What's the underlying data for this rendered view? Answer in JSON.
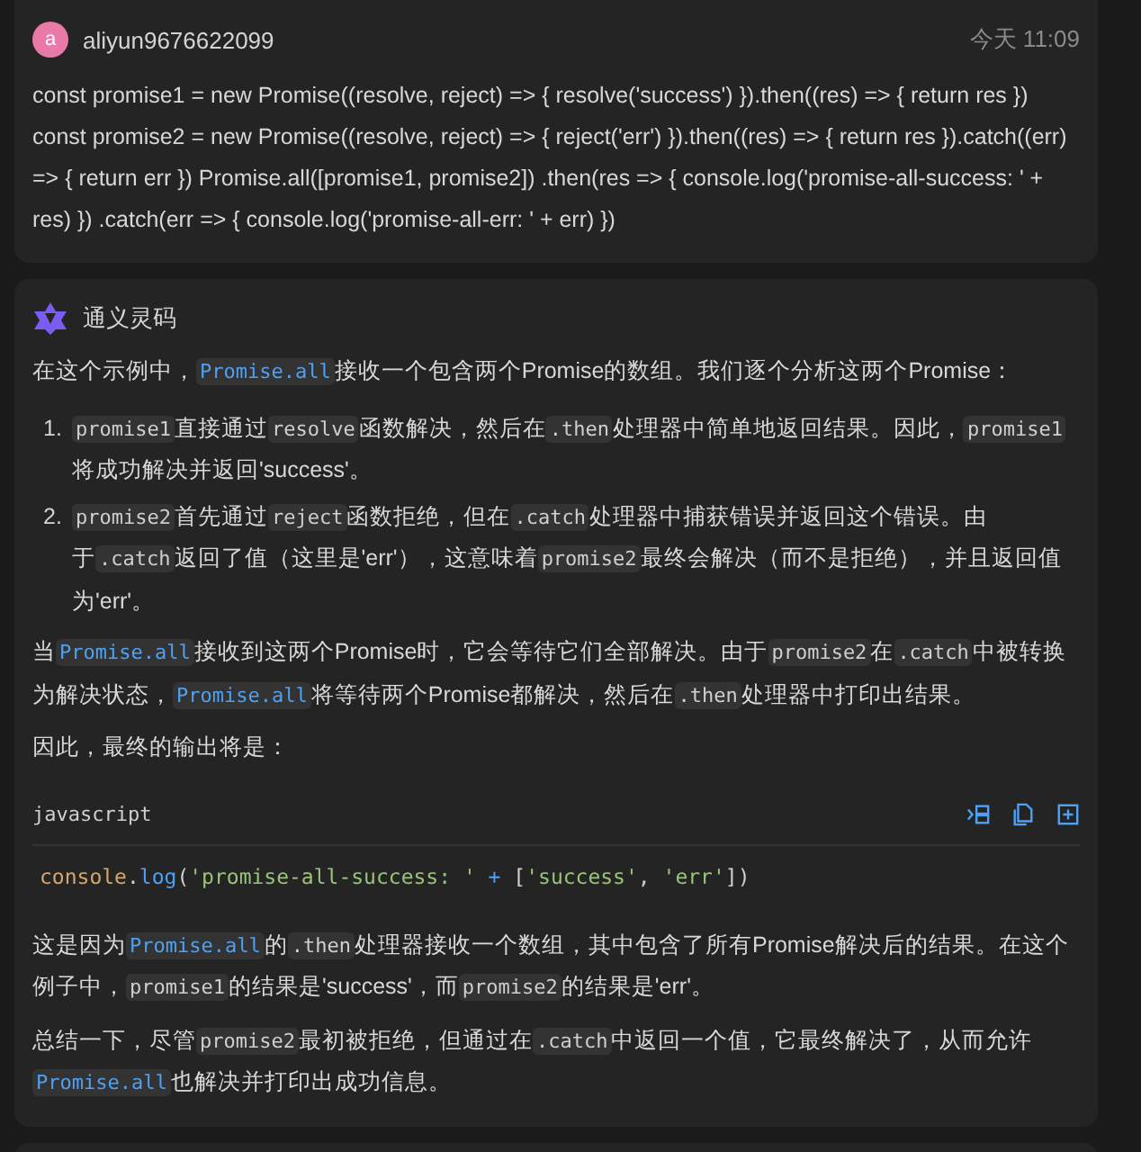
{
  "user_message": {
    "avatar_letter": "a",
    "username": "aliyun9676622099",
    "time": "今天 11:09",
    "text": "const promise1 = new Promise((resolve, reject) => { resolve('success') }).then((res) => { return res }) const promise2 = new Promise((resolve, reject) => { reject('err') }).then((res) => { return res }).catch((err) => { return err }) Promise.all([promise1, promise2]) .then(res => { console.log('promise-all-success:  ' + res) }) .catch(err => { console.log('promise-all-err:  ' + err) })"
  },
  "assistant_message": {
    "name": "通义灵码",
    "blocks": [
      {
        "kind": "paragraph",
        "segments": [
          {
            "kind": "text",
            "text": "在这个示例中，"
          },
          {
            "kind": "api",
            "text": "Promise.all"
          },
          {
            "kind": "text",
            "text": "接收一个包含两个Promise的数组。我们逐个分析这两个Promise："
          }
        ]
      },
      {
        "kind": "list",
        "items": [
          {
            "number": "1.",
            "segments": [
              {
                "kind": "code",
                "text": "promise1"
              },
              {
                "kind": "text",
                "text": "直接通过"
              },
              {
                "kind": "code",
                "text": "resolve"
              },
              {
                "kind": "text",
                "text": "函数解决，然后在"
              },
              {
                "kind": "code",
                "text": ".then"
              },
              {
                "kind": "text",
                "text": "处理器中简单地返回结果。因此，"
              },
              {
                "kind": "code",
                "text": "promise1"
              },
              {
                "kind": "text",
                "text": "将成功解决并返回'success'。"
              }
            ]
          },
          {
            "number": "2.",
            "segments": [
              {
                "kind": "code",
                "text": "promise2"
              },
              {
                "kind": "text",
                "text": "首先通过"
              },
              {
                "kind": "code",
                "text": "reject"
              },
              {
                "kind": "text",
                "text": "函数拒绝，但在"
              },
              {
                "kind": "code",
                "text": ".catch"
              },
              {
                "kind": "text",
                "text": "处理器中捕获错误并返回这个错误。由于"
              },
              {
                "kind": "code",
                "text": ".catch"
              },
              {
                "kind": "text",
                "text": "返回了值（这里是'err'），这意味着"
              },
              {
                "kind": "code",
                "text": "promise2"
              },
              {
                "kind": "text",
                "text": "最终会解决（而不是拒绝），并且返回值为'err'。"
              }
            ]
          }
        ]
      },
      {
        "kind": "paragraph",
        "segments": [
          {
            "kind": "text",
            "text": "当"
          },
          {
            "kind": "api",
            "text": "Promise.all"
          },
          {
            "kind": "text",
            "text": "接收到这两个Promise时，它会等待它们全部解决。由于"
          },
          {
            "kind": "code",
            "text": "promise2"
          },
          {
            "kind": "text",
            "text": "在"
          },
          {
            "kind": "code",
            "text": ".catch"
          },
          {
            "kind": "text",
            "text": "中被转换为解决状态，"
          },
          {
            "kind": "api",
            "text": "Promise.all"
          },
          {
            "kind": "text",
            "text": "将等待两个Promise都解决，然后在"
          },
          {
            "kind": "code",
            "text": ".then"
          },
          {
            "kind": "text",
            "text": "处理器中打印出结果。"
          }
        ]
      },
      {
        "kind": "paragraph",
        "segments": [
          {
            "kind": "text",
            "text": "因此，最终的输出将是："
          }
        ]
      },
      {
        "kind": "code_block",
        "language": "javascript",
        "tokens": [
          {
            "kind": "object",
            "text": "console"
          },
          {
            "kind": "plain",
            "text": "."
          },
          {
            "kind": "method",
            "text": "log"
          },
          {
            "kind": "plain",
            "text": "("
          },
          {
            "kind": "string",
            "text": "'promise-all-success: '"
          },
          {
            "kind": "operator",
            "text": " +"
          },
          {
            "kind": "plain",
            "text": " ["
          },
          {
            "kind": "string",
            "text": "'success'"
          },
          {
            "kind": "plain",
            "text": ", "
          },
          {
            "kind": "string",
            "text": "'err'"
          },
          {
            "kind": "plain",
            "text": "])"
          }
        ]
      },
      {
        "kind": "paragraph",
        "segments": [
          {
            "kind": "text",
            "text": "这是因为"
          },
          {
            "kind": "api",
            "text": "Promise.all"
          },
          {
            "kind": "text",
            "text": "的"
          },
          {
            "kind": "code",
            "text": ".then"
          },
          {
            "kind": "text",
            "text": "处理器接收一个数组，其中包含了所有Promise解决后的结果。在这个例子中，"
          },
          {
            "kind": "code",
            "text": "promise1"
          },
          {
            "kind": "text",
            "text": "的结果是'success'，而"
          },
          {
            "kind": "code",
            "text": "promise2"
          },
          {
            "kind": "text",
            "text": "的结果是'err'。"
          }
        ]
      },
      {
        "kind": "paragraph",
        "segments": [
          {
            "kind": "text",
            "text": "总结一下，尽管"
          },
          {
            "kind": "code",
            "text": "promise2"
          },
          {
            "kind": "text",
            "text": "最初被拒绝，但通过在"
          },
          {
            "kind": "code",
            "text": ".catch"
          },
          {
            "kind": "text",
            "text": "中返回一个值，它最终解决了，从而允许"
          },
          {
            "kind": "api",
            "text": "Promise.all"
          },
          {
            "kind": "text",
            "text": "也解决并打印出成功信息。"
          }
        ]
      }
    ]
  }
}
